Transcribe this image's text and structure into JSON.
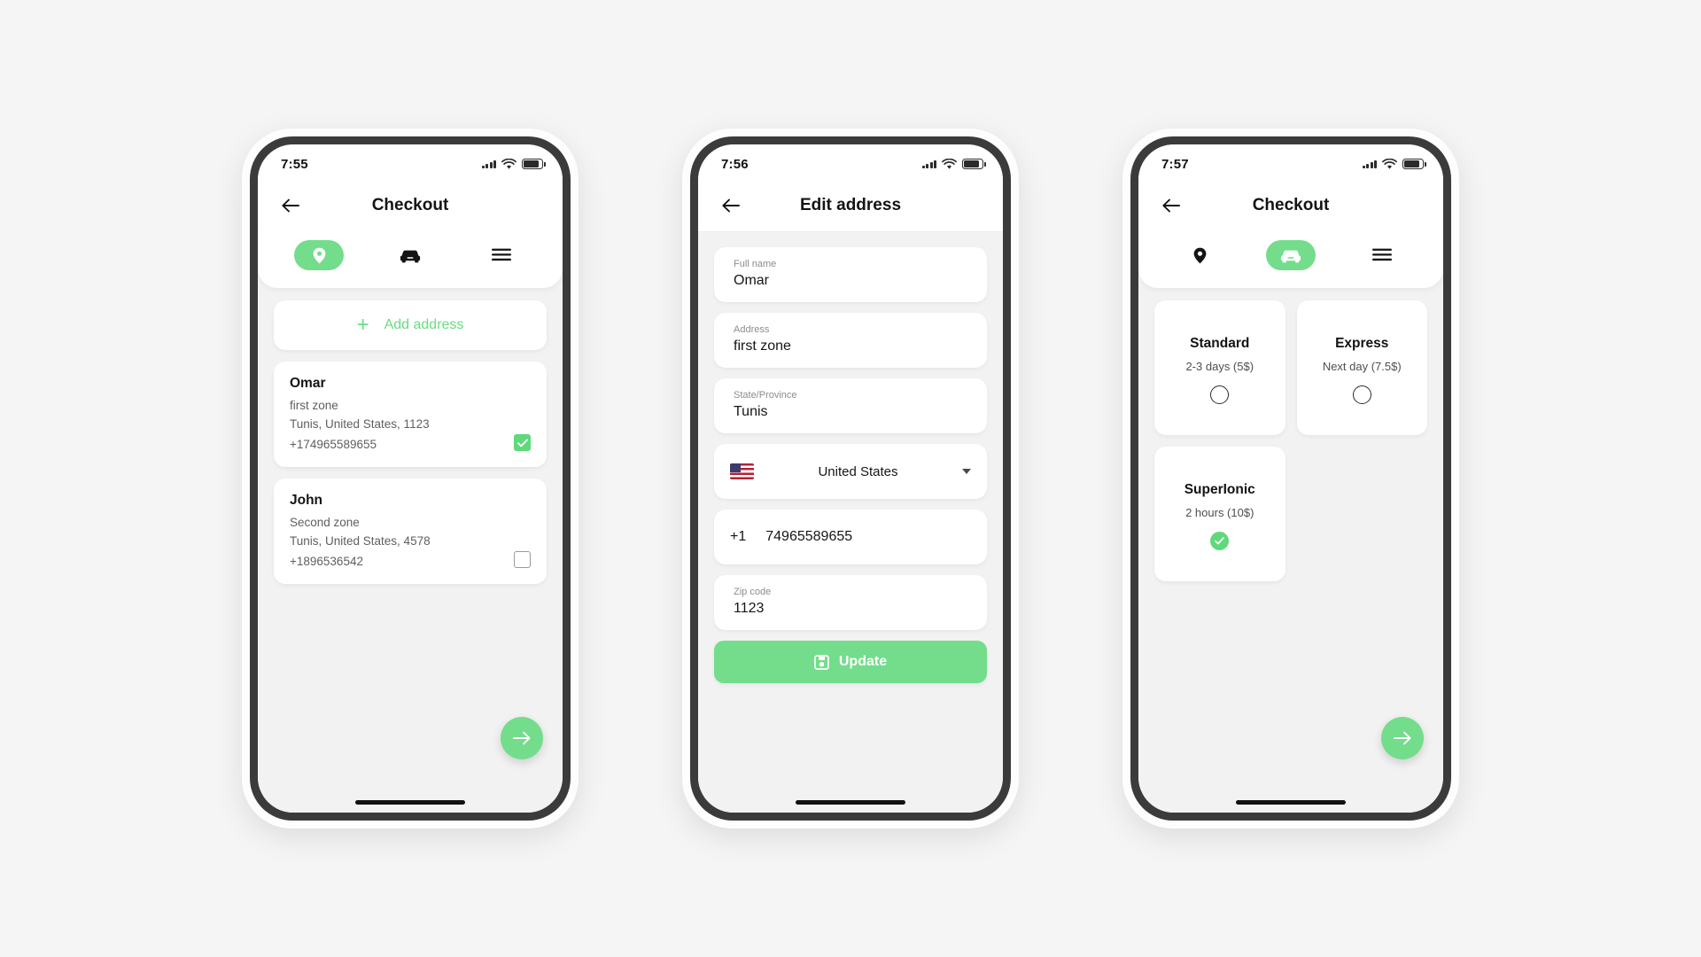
{
  "theme": {
    "accent": "#73dd8b",
    "accent_text": "#67dd81",
    "check_green": "#5fd97a",
    "page_bg": "#f5f5f5",
    "screen_bg": "#f2f2f2",
    "card_bg": "#ffffff"
  },
  "screens": [
    {
      "id": "checkout-address",
      "status": {
        "time": "7:55",
        "wifi_icon": "wifi-icon",
        "battery_icon": "battery-icon",
        "signal_icon": "signal-dots-icon"
      },
      "appbar": {
        "title": "Checkout",
        "back_icon": "arrow-left-icon"
      },
      "steps": [
        {
          "icon": "location-pin-icon",
          "name": "address",
          "active": true
        },
        {
          "icon": "car-icon",
          "name": "delivery",
          "active": false
        },
        {
          "icon": "list-icon",
          "name": "summary",
          "active": false
        }
      ],
      "add_address": {
        "label": "Add address",
        "plus_icon": "plus-icon"
      },
      "addresses": [
        {
          "name": "Omar",
          "street": "first zone",
          "city_line": "Tunis, United States, 1123",
          "phone": "+174965589655",
          "selected": true
        },
        {
          "name": "John",
          "street": "Second zone",
          "city_line": "Tunis, United States, 4578",
          "phone": "+1896536542",
          "selected": false
        }
      ],
      "fab": {
        "icon": "arrow-right-icon"
      }
    },
    {
      "id": "edit-address",
      "status": {
        "time": "7:56",
        "wifi_icon": "wifi-icon",
        "battery_icon": "battery-icon",
        "signal_icon": "signal-dots-icon"
      },
      "appbar": {
        "title": "Edit address",
        "back_icon": "arrow-left-icon"
      },
      "fields": [
        {
          "label": "Full name",
          "value": "Omar"
        },
        {
          "label": "Address",
          "value": "first zone"
        },
        {
          "label": "State/Province",
          "value": "Tunis"
        }
      ],
      "country": {
        "flag_icon": "us-flag-icon",
        "name": "United States",
        "caret_icon": "chevron-down-icon"
      },
      "phone": {
        "code": "+1",
        "number": "74965589655"
      },
      "zip": {
        "label": "Zip code",
        "value": "1123"
      },
      "update_button": {
        "label": "Update",
        "icon": "save-icon"
      }
    },
    {
      "id": "checkout-delivery",
      "status": {
        "time": "7:57",
        "wifi_icon": "wifi-icon",
        "battery_icon": "battery-icon",
        "signal_icon": "signal-dots-icon"
      },
      "appbar": {
        "title": "Checkout",
        "back_icon": "arrow-left-icon"
      },
      "steps": [
        {
          "icon": "location-pin-icon",
          "name": "address",
          "active": false
        },
        {
          "icon": "car-icon",
          "name": "delivery",
          "active": true
        },
        {
          "icon": "list-icon",
          "name": "summary",
          "active": false
        }
      ],
      "delivery_options": [
        {
          "title": "Standard",
          "subtitle": "2-3 days (5$)",
          "selected": false
        },
        {
          "title": "Express",
          "subtitle": "Next day (7.5$)",
          "selected": false
        },
        {
          "title": "SuperIonic",
          "subtitle": "2 hours (10$)",
          "selected": true
        }
      ],
      "fab": {
        "icon": "arrow-right-icon"
      }
    }
  ]
}
